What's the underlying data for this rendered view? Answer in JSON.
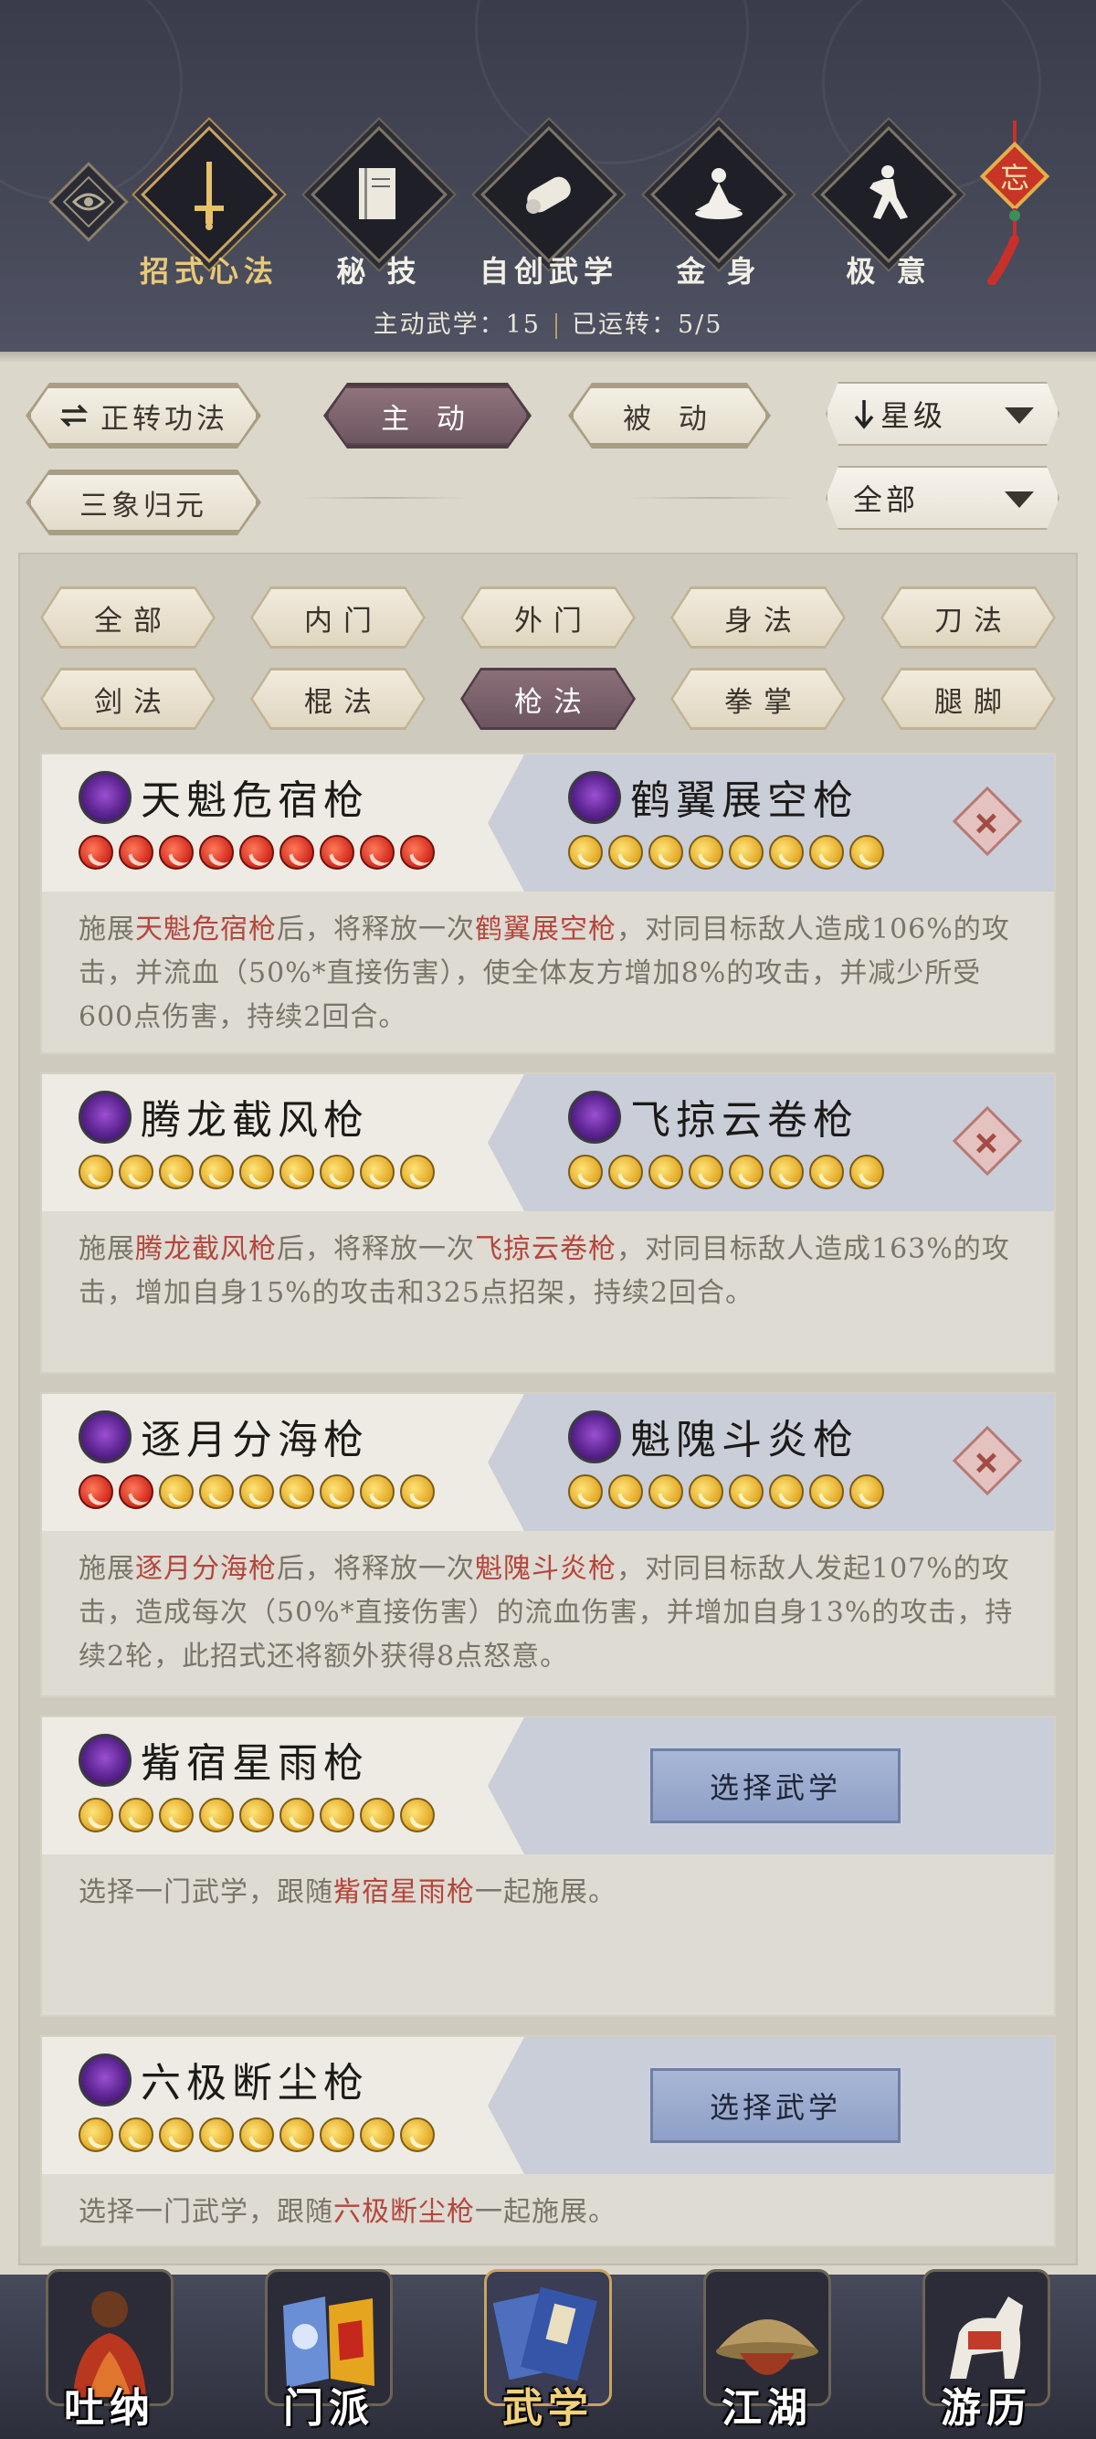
{
  "header": {
    "categories": [
      {
        "label": "招式心法",
        "icon": "sword-icon",
        "active": true
      },
      {
        "label": "秘 技",
        "icon": "book-icon"
      },
      {
        "label": "自创武学",
        "icon": "scroll-icon"
      },
      {
        "label": "金 身",
        "icon": "meditation-icon"
      },
      {
        "label": "极 意",
        "icon": "martial-pose-icon"
      }
    ],
    "knot_char": "忘",
    "summary": {
      "active_label": "主动武学：",
      "active_count": "15",
      "running_label": "已运转：",
      "running_count": "5/5"
    }
  },
  "controls": {
    "cycle_button": "正转功法",
    "tabs": [
      "主 动",
      "被 动"
    ],
    "sort_select": "星级",
    "preset_button": "三象归元",
    "filter_select": "全部"
  },
  "filters": [
    "全部",
    "内门",
    "外门",
    "身法",
    "刀法",
    "剑法",
    "棍法",
    "枪法",
    "拳掌",
    "腿脚"
  ],
  "selected_filter": "枪法",
  "combos": [
    {
      "left": {
        "name": "天魁危宿枪",
        "stars_red": 9,
        "stars_gold": 0
      },
      "right": {
        "name": "鹤翼展空枪",
        "stars_red": 0,
        "stars_gold": 8
      },
      "desc": {
        "p1": "施展",
        "h1": "天魁危宿枪",
        "p2": "后，将释放一次",
        "h2": "鹤翼展空枪",
        "p3": "，对同目标敌人造成106%的攻击，并流血（50%*直接伤害），使全体友方增加8%的攻击，并减少所受600点伤害，持续2回合。"
      }
    },
    {
      "left": {
        "name": "腾龙截风枪",
        "stars_red": 0,
        "stars_gold": 9
      },
      "right": {
        "name": "飞掠云卷枪",
        "stars_red": 0,
        "stars_gold": 8
      },
      "desc": {
        "p1": "施展",
        "h1": "腾龙截风枪",
        "p2": "后，将释放一次",
        "h2": "飞掠云卷枪",
        "p3": "，对同目标敌人造成163%的攻击，增加自身15%的攻击和325点招架，持续2回合。"
      }
    },
    {
      "left": {
        "name": "逐月分海枪",
        "stars_red": 2,
        "stars_gold": 7
      },
      "right": {
        "name": "魁隗斗炎枪",
        "stars_red": 0,
        "stars_gold": 8
      },
      "desc": {
        "p1": "施展",
        "h1": "逐月分海枪",
        "p2": "后，将释放一次",
        "h2": "魁隗斗炎枪",
        "p3": "，对同目标敌人发起107%的攻击，造成每次（50%*直接伤害）的流血伤害，并增加自身13%的攻击，持续2轮，此招式还将额外获得8点怒意。"
      }
    }
  ],
  "single_cards": [
    {
      "name": "觜宿星雨枪",
      "stars_gold": 9,
      "button": "选择武学",
      "desc": {
        "p1": "选择一门武学，跟随",
        "h1": "觜宿星雨枪",
        "p2": "一起施展。"
      }
    },
    {
      "name": "六极断尘枪",
      "stars_gold": 9,
      "button": "选择武学",
      "desc": {
        "p1": "选择一门武学，跟随",
        "h1": "六极断尘枪",
        "p2": "一起施展。"
      }
    }
  ],
  "bottom_nav": [
    {
      "label": "吐纳",
      "icon": "monk-portrait-icon"
    },
    {
      "label": "门派",
      "icon": "sect-banner-icon"
    },
    {
      "label": "武学",
      "icon": "martial-books-icon",
      "active": true
    },
    {
      "label": "江湖",
      "icon": "straw-hat-icon"
    },
    {
      "label": "游历",
      "icon": "horse-icon"
    }
  ],
  "colors": {
    "header_bg": "#3a3c4c",
    "panel_bg": "#dcd7cb",
    "selected_tab": "#6e5660",
    "highlight_text": "#b4463d",
    "gold_accent": "#e8c979",
    "select_button": "#8ea0c8"
  }
}
